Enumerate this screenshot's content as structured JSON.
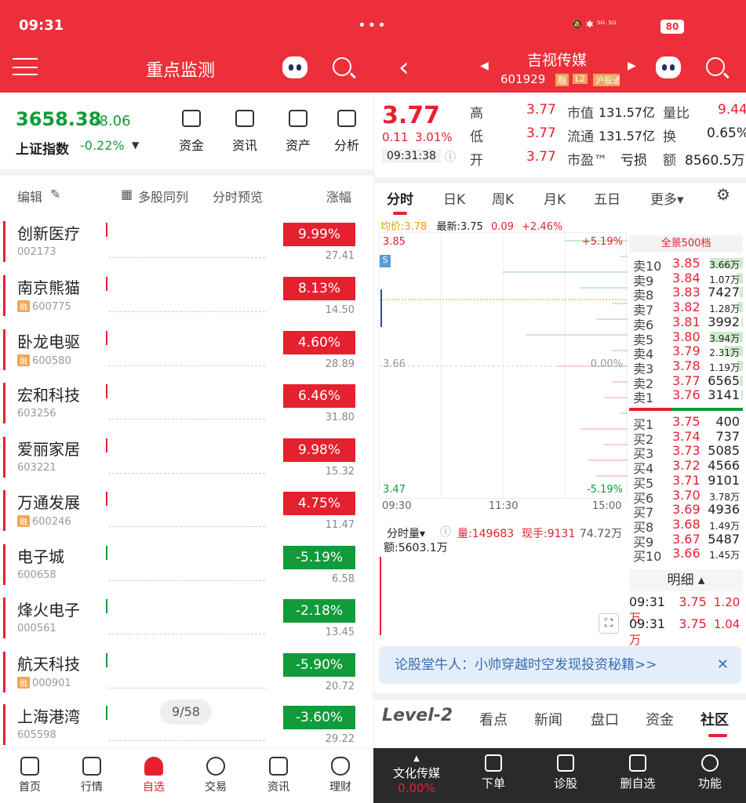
{
  "status_bar": {
    "time": "09:31",
    "dots": "•••",
    "icons": "🔕 ✱ ⁵ᴳ ⁵ᴳ",
    "battery": "80"
  },
  "left_header": {
    "title": "重点监测"
  },
  "right_header": {
    "stock_name": "吉视传媒",
    "code": "601929",
    "tags": [
      "融",
      "L2",
      "沪股通"
    ]
  },
  "index": {
    "value": "3658.38",
    "change": "-8.06",
    "name": "上证指数",
    "pct": "-0.22%"
  },
  "quick_tools": [
    "资金",
    "资讯",
    "资产",
    "分析"
  ],
  "list_controls": {
    "edit": "编辑",
    "multi": "多股同列",
    "preview": "分时预览",
    "sort": "涨幅"
  },
  "stocks": [
    {
      "name": "创新医疗",
      "code": "002173",
      "rong": false,
      "pct": "9.99%",
      "price": "27.41",
      "up": true
    },
    {
      "name": "南京熊猫",
      "code": "600775",
      "rong": true,
      "pct": "8.13%",
      "price": "14.50",
      "up": true
    },
    {
      "name": "卧龙电驱",
      "code": "600580",
      "rong": true,
      "pct": "4.60%",
      "price": "28.89",
      "up": true
    },
    {
      "name": "宏和科技",
      "code": "603256",
      "rong": false,
      "pct": "6.46%",
      "price": "31.80",
      "up": true
    },
    {
      "name": "爱丽家居",
      "code": "603221",
      "rong": false,
      "pct": "9.98%",
      "price": "15.32",
      "up": true
    },
    {
      "name": "万通发展",
      "code": "600246",
      "rong": true,
      "pct": "4.75%",
      "price": "11.47",
      "up": true
    },
    {
      "name": "电子城",
      "code": "600658",
      "rong": false,
      "pct": "-5.19%",
      "price": "6.58",
      "up": false
    },
    {
      "name": "烽火电子",
      "code": "000561",
      "rong": false,
      "pct": "-2.18%",
      "price": "13.45",
      "up": false
    },
    {
      "name": "航天科技",
      "code": "000901",
      "rong": true,
      "pct": "-5.90%",
      "price": "20.72",
      "up": false
    },
    {
      "name": "上海港湾",
      "code": "605598",
      "rong": false,
      "pct": "-3.60%",
      "price": "29.22",
      "up": false
    }
  ],
  "rong_label": "融",
  "pager": "9/58",
  "left_nav": [
    {
      "label": "首页",
      "icon": "home-icon"
    },
    {
      "label": "行情",
      "icon": "market-icon"
    },
    {
      "label": "自选",
      "icon": "watchlist-icon",
      "active": true
    },
    {
      "label": "交易",
      "icon": "trade-icon"
    },
    {
      "label": "资讯",
      "icon": "news-icon"
    },
    {
      "label": "理财",
      "icon": "wealth-icon"
    }
  ],
  "quote": {
    "price": "3.77",
    "change": "0.11",
    "pct": "3.01%",
    "time": "09:31:38",
    "high_label": "高",
    "high": "3.77",
    "low_label": "低",
    "low": "3.77",
    "open_label": "开",
    "open": "3.77",
    "mktcap_label": "市值",
    "mktcap": "131.57亿",
    "float_label": "流通",
    "float": "131.57亿",
    "pe_label": "市盈™",
    "pe": "亏损",
    "vr_label": "量比",
    "vr": "9.44",
    "turnover_label": "换",
    "turnover": "0.65%",
    "amount_label": "额",
    "amount": "8560.5万"
  },
  "chart_tabs": [
    "分时",
    "日K",
    "周K",
    "月K",
    "五日",
    "更多▾"
  ],
  "legend": {
    "avg": "均价:3.78",
    "latest": "最新:3.75",
    "chg": "0.09",
    "pct": "+2.46%"
  },
  "chart_data": {
    "type": "line",
    "ylim": [
      3.47,
      3.85
    ],
    "y_top": "3.85",
    "y_mid": "3.66",
    "y_bottom": "3.47",
    "pct_top": "+5.19%",
    "pct_mid": "0.00%",
    "pct_bottom": "-5.19%",
    "x_ticks": [
      "09:30",
      "11:30",
      "15:00"
    ],
    "marker": "S"
  },
  "volume": {
    "mode": "分时量▾",
    "vol": "量:149683",
    "now": "现手:9131",
    "max": "74.72万",
    "amount": "额:5603.1万"
  },
  "orderbook": {
    "header": "全景500档",
    "asks": [
      {
        "label": "卖10",
        "price": "3.85",
        "vol": "3.66万",
        "small": true,
        "bar": 0.95
      },
      {
        "label": "卖9",
        "price": "3.84",
        "vol": "1.07万",
        "small": true,
        "bar": 0.15
      },
      {
        "label": "卖8",
        "price": "3.83",
        "vol": "7427",
        "small": false,
        "bar": 0.1
      },
      {
        "label": "卖7",
        "price": "3.82",
        "vol": "1.28万",
        "small": true,
        "bar": 0.15
      },
      {
        "label": "卖6",
        "price": "3.81",
        "vol": "3992",
        "small": false,
        "bar": 0.05
      },
      {
        "label": "卖5",
        "price": "3.80",
        "vol": "3.94万",
        "small": true,
        "bar": 0.95
      },
      {
        "label": "卖4",
        "price": "3.79",
        "vol": "2.31万",
        "small": true,
        "bar": 0.55
      },
      {
        "label": "卖3",
        "price": "3.78",
        "vol": "1.19万",
        "small": true,
        "bar": 0.15
      },
      {
        "label": "卖2",
        "price": "3.77",
        "vol": "6565",
        "small": false,
        "bar": 0.08
      },
      {
        "label": "卖1",
        "price": "3.76",
        "vol": "3141",
        "small": false,
        "bar": 0.04
      }
    ],
    "bids": [
      {
        "label": "买1",
        "price": "3.75",
        "vol": "400",
        "small": false
      },
      {
        "label": "买2",
        "price": "3.74",
        "vol": "737",
        "small": false
      },
      {
        "label": "买3",
        "price": "3.73",
        "vol": "5085",
        "small": false
      },
      {
        "label": "买4",
        "price": "3.72",
        "vol": "4566",
        "small": false
      },
      {
        "label": "买5",
        "price": "3.71",
        "vol": "9101",
        "small": false
      },
      {
        "label": "买6",
        "price": "3.70",
        "vol": "3.78万",
        "small": true
      },
      {
        "label": "买7",
        "price": "3.69",
        "vol": "4936",
        "small": false
      },
      {
        "label": "买8",
        "price": "3.68",
        "vol": "1.49万",
        "small": true
      },
      {
        "label": "买9",
        "price": "3.67",
        "vol": "5487",
        "small": false
      },
      {
        "label": "买10",
        "price": "3.66",
        "vol": "1.45万",
        "small": true
      }
    ]
  },
  "detail": {
    "header": "明细 ▴",
    "rows": [
      {
        "time": "09:31",
        "price": "3.75",
        "vol": "1.20万"
      },
      {
        "time": "09:31",
        "price": "3.75",
        "vol": "1.04万"
      }
    ]
  },
  "banner": {
    "text": "论股堂牛人：小帅穿越时空发现投资秘籍>>",
    "close": "✕"
  },
  "bottom_tabs": [
    "Level-2",
    "看点",
    "新闻",
    "盘口",
    "资金",
    "社区"
  ],
  "right_nav": [
    {
      "label": "文化传媒",
      "sub": "0.00%",
      "icon": "sector-icon"
    },
    {
      "label": "下单",
      "icon": "order-icon"
    },
    {
      "label": "诊股",
      "icon": "diagnose-icon"
    },
    {
      "label": "删自选",
      "icon": "remove-watch-icon"
    },
    {
      "label": "功能",
      "icon": "menu-icon"
    }
  ],
  "colors": {
    "red": "#e5212f",
    "green": "#119b3a",
    "header": "#ec2f3a"
  }
}
